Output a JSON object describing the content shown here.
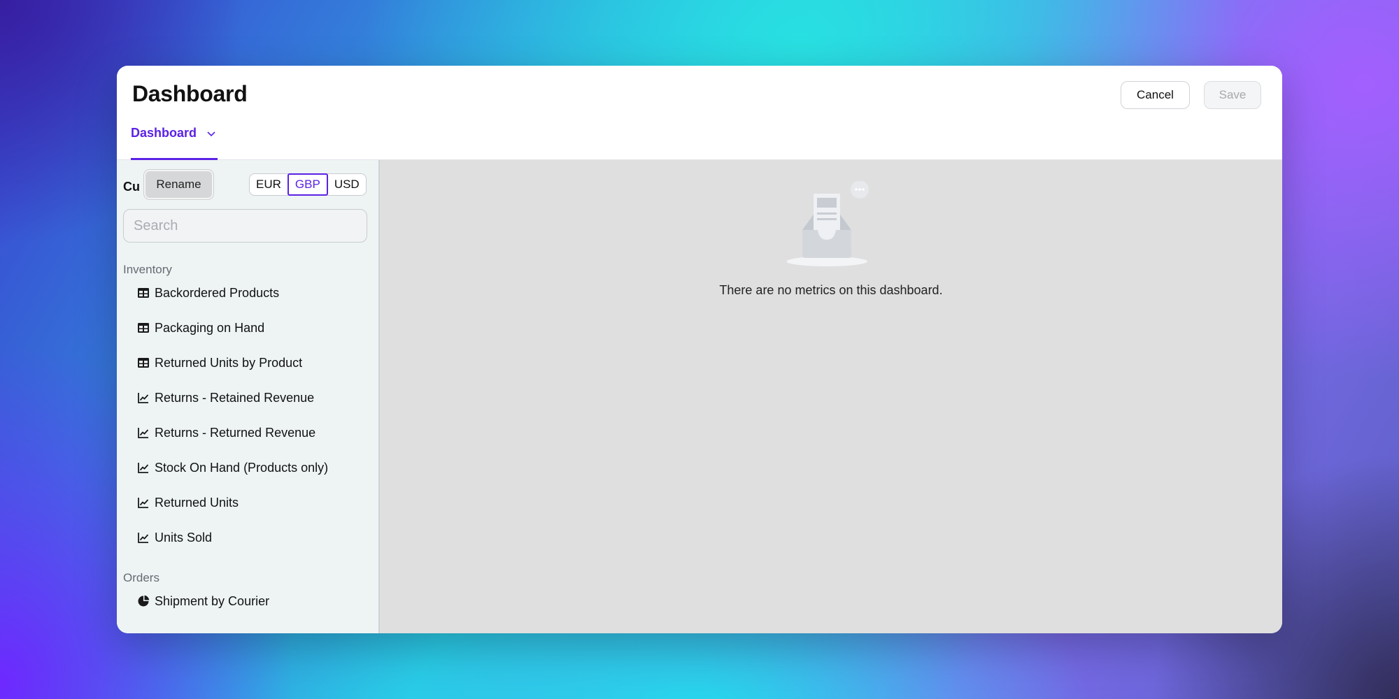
{
  "header": {
    "title": "Dashboard",
    "cancel_label": "Cancel",
    "save_label": "Save",
    "tab_label": "Dashboard"
  },
  "sidebar": {
    "currency_label": "Cu",
    "rename_label": "Rename",
    "currencies": [
      "EUR",
      "GBP",
      "USD"
    ],
    "selected_currency": "GBP",
    "search_placeholder": "Search",
    "sections": [
      {
        "title": "Inventory",
        "items": [
          {
            "label": "Backordered Products",
            "icon": "table-icon"
          },
          {
            "label": "Packaging on Hand",
            "icon": "table-icon"
          },
          {
            "label": "Returned Units by Product",
            "icon": "table-icon"
          },
          {
            "label": "Returns - Retained Revenue",
            "icon": "line-chart-icon"
          },
          {
            "label": "Returns - Returned Revenue",
            "icon": "line-chart-icon"
          },
          {
            "label": "Stock On Hand (Products only)",
            "icon": "line-chart-icon"
          },
          {
            "label": "Returned Units",
            "icon": "line-chart-icon"
          },
          {
            "label": "Units Sold",
            "icon": "line-chart-icon"
          }
        ]
      },
      {
        "title": "Orders",
        "items": [
          {
            "label": "Shipment by Courier",
            "icon": "pie-chart-icon"
          }
        ]
      }
    ]
  },
  "main": {
    "empty_message": "There are no metrics on this dashboard."
  },
  "colors": {
    "accent": "#5b21e6",
    "sidebar_bg": "#eef4f4",
    "canvas_bg": "#dfdfdf"
  }
}
